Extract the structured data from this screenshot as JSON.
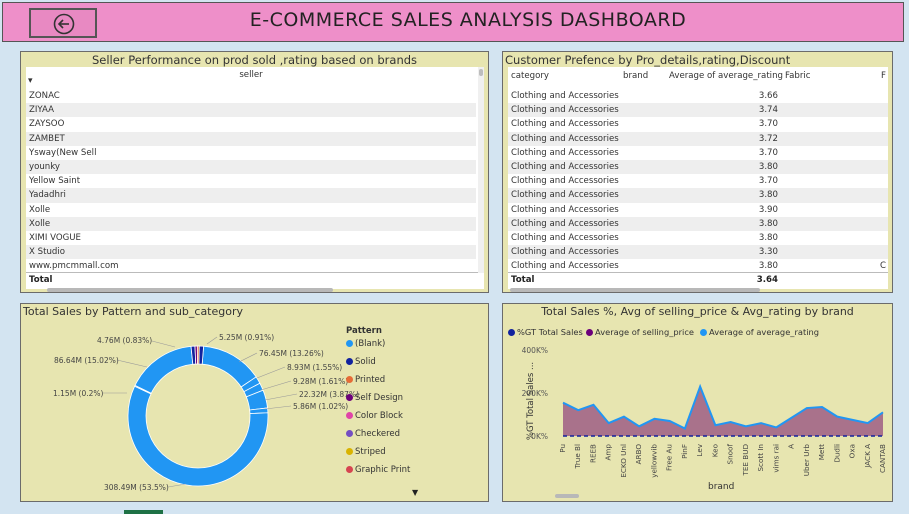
{
  "header": {
    "title": "E-COMMERCE SALES ANALYSIS DASHBOARD",
    "back_icon": "arrow-left-circle-icon"
  },
  "seller_panel": {
    "title": "Seller Performance on prod sold ,rating based on brands",
    "column": "seller",
    "rows": [
      "ZONAC",
      "ZIYAA",
      "ZAYSOO",
      "ZAMBET",
      "Ysway(New Sell",
      "younky",
      "Yellow Saint",
      "Yadadhri",
      "Xolle",
      "Xolle",
      "XIMI VOGUE",
      "X Studio",
      "www.pmcmmall.com"
    ],
    "total_label": "Total"
  },
  "customer_panel": {
    "title": "Customer Prefence by Pro_details,rating,Discount",
    "columns": [
      "category",
      "brand",
      "Average of average_rating",
      "Fabric",
      "F"
    ],
    "rows": [
      {
        "category": "Clothing and Accessories",
        "rating": "3.66"
      },
      {
        "category": "Clothing and Accessories",
        "rating": "3.74"
      },
      {
        "category": "Clothing and Accessories",
        "rating": "3.70"
      },
      {
        "category": "Clothing and Accessories",
        "rating": "3.72"
      },
      {
        "category": "Clothing and Accessories",
        "rating": "3.70"
      },
      {
        "category": "Clothing and Accessories",
        "rating": "3.80"
      },
      {
        "category": "Clothing and Accessories",
        "rating": "3.70"
      },
      {
        "category": "Clothing and Accessories",
        "rating": "3.80"
      },
      {
        "category": "Clothing and Accessories",
        "rating": "3.90"
      },
      {
        "category": "Clothing and Accessories",
        "rating": "3.80"
      },
      {
        "category": "Clothing and Accessories",
        "rating": "3.80"
      },
      {
        "category": "Clothing and Accessories",
        "rating": "3.30"
      },
      {
        "category": "Clothing and Accessories",
        "rating": "3.80",
        "extra": "C"
      }
    ],
    "total_label": "Total",
    "total_value": "3.64"
  },
  "pie_panel": {
    "title": "Total Sales by Pattern and sub_category",
    "legend_title": "Pattern",
    "legend": [
      {
        "name": "(Blank)",
        "color": "#2196f3"
      },
      {
        "name": "Solid",
        "color": "#12239e"
      },
      {
        "name": "Printed",
        "color": "#e66c37"
      },
      {
        "name": "Self Design",
        "color": "#6b007b"
      },
      {
        "name": "Color Block",
        "color": "#e044a7"
      },
      {
        "name": "Checkered",
        "color": "#744ec2"
      },
      {
        "name": "Striped",
        "color": "#d9b300"
      },
      {
        "name": "Graphic Print",
        "color": "#d64550"
      }
    ],
    "labels": [
      "5.25M (0.91%)",
      "76.45M (13.26%)",
      "8.93M (1.55%)",
      "9.28M (1.61%)",
      "22.32M (3.87%)",
      "5.86M (1.02%)",
      "4.76M (0.83%)",
      "86.64M (15.02%)",
      "1.15M (0.2%)",
      "308.49M (53.5%)"
    ]
  },
  "chart_panel": {
    "title": "Total Sales %, Avg of selling_price & Avg_rating by brand",
    "legend": [
      {
        "name": "%GT Total Sales",
        "color": "#12239e"
      },
      {
        "name": "Average of selling_price",
        "color": "#6b007b"
      },
      {
        "name": "Average of average_rating",
        "color": "#2196f3"
      }
    ],
    "y_axis_label": "%GT Total Sales ...",
    "x_axis_label": "brand",
    "y_ticks": [
      "400K%",
      "200K%",
      "0K%"
    ]
  },
  "chart_data": {
    "type": "area",
    "title": "Total Sales %, Avg of selling_price & Avg_rating by brand",
    "xlabel": "brand",
    "ylabel": "%GT Total Sales ...",
    "ylim": [
      0,
      400000
    ],
    "categories": [
      "Pu",
      "True Bl",
      "REEB",
      "Amp",
      "ECKO Unl",
      "ARBO",
      "yellowvib",
      "Free Au",
      "PinF",
      "Lev",
      "Keo",
      "Snoof",
      "TEE BUD",
      "Scott In",
      "vims rai",
      "A",
      "Uber Urb",
      "Mett",
      "Dudli",
      "Oxa",
      "JACK A",
      "CANTAB"
    ],
    "series": [
      {
        "name": "Average of selling_price",
        "color": "#6b007b",
        "values": [
          155000,
          120000,
          145000,
          60000,
          90000,
          45000,
          80000,
          70000,
          35000,
          230000,
          50000,
          65000,
          45000,
          60000,
          40000,
          85000,
          130000,
          135000,
          90000,
          75000,
          60000,
          110000
        ]
      },
      {
        "name": "%GT Total Sales",
        "color": "#12239e",
        "values": [
          0,
          0,
          0,
          0,
          0,
          0,
          0,
          0,
          0,
          0,
          0,
          0,
          0,
          0,
          0,
          0,
          0,
          0,
          0,
          0,
          0,
          0
        ]
      }
    ],
    "legend_position": "top-left"
  }
}
